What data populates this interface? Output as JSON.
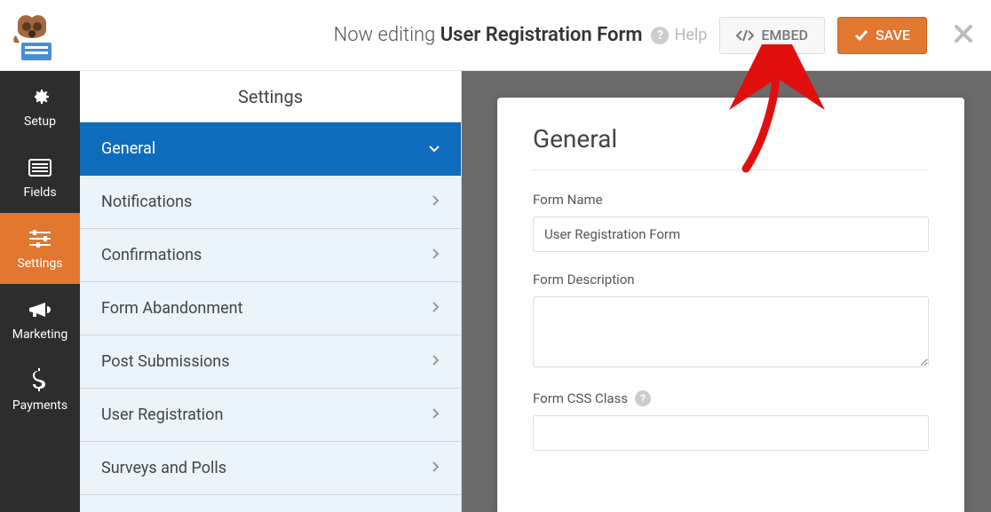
{
  "topbar": {
    "editing_prefix": "Now editing",
    "form_title": "User Registration Form",
    "help_label": "Help",
    "embed_label": "EMBED",
    "save_label": "SAVE"
  },
  "leftnav": {
    "items": [
      {
        "label": "Setup"
      },
      {
        "label": "Fields"
      },
      {
        "label": "Settings"
      },
      {
        "label": "Marketing"
      },
      {
        "label": "Payments"
      }
    ],
    "active_index": 2
  },
  "settings": {
    "title": "Settings",
    "items": [
      {
        "label": "General"
      },
      {
        "label": "Notifications"
      },
      {
        "label": "Confirmations"
      },
      {
        "label": "Form Abandonment"
      },
      {
        "label": "Post Submissions"
      },
      {
        "label": "User Registration"
      },
      {
        "label": "Surveys and Polls"
      }
    ],
    "active_index": 0
  },
  "panel": {
    "heading": "General",
    "form_name_label": "Form Name",
    "form_name_value": "User Registration Form",
    "form_description_label": "Form Description",
    "form_description_value": "",
    "form_css_label": "Form CSS Class"
  },
  "colors": {
    "accent_orange": "#e27730",
    "accent_blue": "#0e6cbd",
    "panel_bg": "#ebf3fb",
    "dark_sidebar": "#2d2d2d"
  }
}
